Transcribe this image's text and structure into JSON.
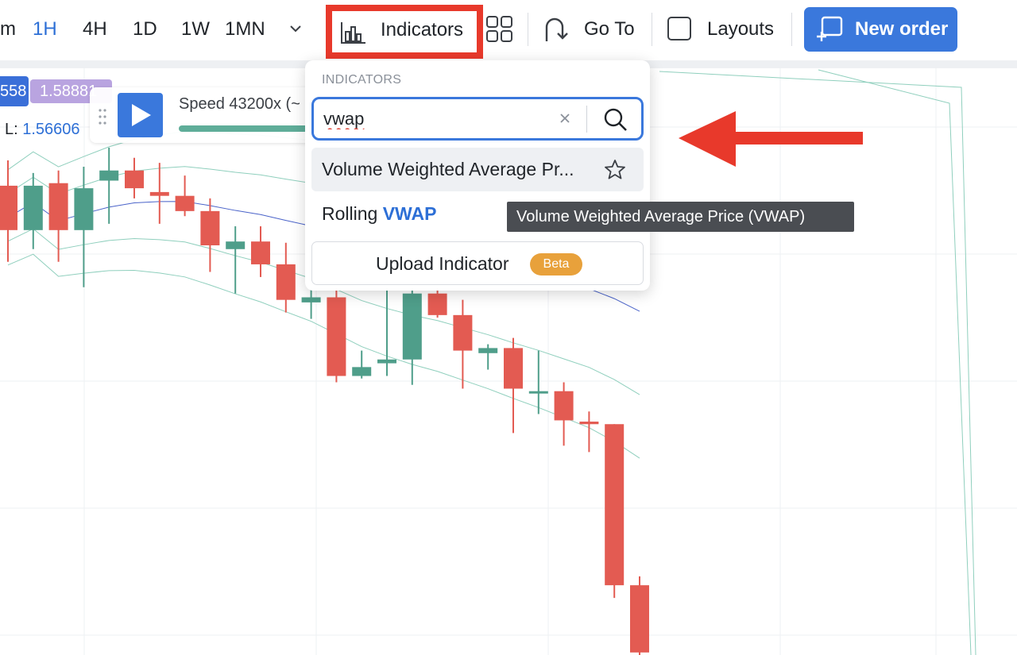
{
  "toolbar": {
    "timeframes": [
      {
        "label": "m",
        "active": false
      },
      {
        "label": "1H",
        "active": true
      },
      {
        "label": "4H",
        "active": false
      },
      {
        "label": "1D",
        "active": false
      },
      {
        "label": "1W",
        "active": false
      },
      {
        "label": "1MN",
        "active": false
      }
    ],
    "indicators_label": "Indicators",
    "goto_label": "Go To",
    "layouts_label": "Layouts",
    "new_order_label": "New order"
  },
  "price_labels": {
    "blue_tag": "558",
    "purple_tag": "1.58881",
    "low_prefix": "L:",
    "low_value": "1.56606"
  },
  "replay": {
    "speed_text": "Speed 43200x (~"
  },
  "dropdown": {
    "header": "INDICATORS",
    "search_value": "vwap",
    "results": [
      {
        "label": "Volume Weighted Average Pr..."
      },
      {
        "label_prefix": "Rolling ",
        "label_highlight": "VWAP"
      }
    ],
    "upload_label": "Upload Indicator",
    "beta_badge": "Beta"
  },
  "tooltip": "Volume Weighted Average Price (VWAP)",
  "colors": {
    "accent": "#3a78dc",
    "bull": "#4f9e8a",
    "bear": "#e35b52",
    "highlight_box": "#e8392b",
    "vwap_line": "#4a63c9",
    "band_line": "#8fcfbd"
  },
  "candles": [
    {
      "o": 1.57,
      "h": 1.572,
      "l": 1.564,
      "c": 1.5665
    },
    {
      "o": 1.5665,
      "h": 1.571,
      "l": 1.565,
      "c": 1.57
    },
    {
      "o": 1.5702,
      "h": 1.5712,
      "l": 1.564,
      "c": 1.5665
    },
    {
      "o": 1.5665,
      "h": 1.5715,
      "l": 1.562,
      "c": 1.5698
    },
    {
      "o": 1.5704,
      "h": 1.573,
      "l": 1.567,
      "c": 1.5712
    },
    {
      "o": 1.5712,
      "h": 1.5722,
      "l": 1.569,
      "c": 1.5698
    },
    {
      "o": 1.5695,
      "h": 1.5718,
      "l": 1.567,
      "c": 1.5692
    },
    {
      "o": 1.5692,
      "h": 1.5708,
      "l": 1.5676,
      "c": 1.568
    },
    {
      "o": 1.568,
      "h": 1.569,
      "l": 1.5632,
      "c": 1.5653
    },
    {
      "o": 1.565,
      "h": 1.5668,
      "l": 1.5615,
      "c": 1.5656
    },
    {
      "o": 1.5656,
      "h": 1.5668,
      "l": 1.5628,
      "c": 1.5638
    },
    {
      "o": 1.5638,
      "h": 1.5655,
      "l": 1.56,
      "c": 1.561
    },
    {
      "o": 1.5608,
      "h": 1.564,
      "l": 1.5595,
      "c": 1.5612
    },
    {
      "o": 1.5612,
      "h": 1.5622,
      "l": 1.5545,
      "c": 1.555
    },
    {
      "o": 1.555,
      "h": 1.557,
      "l": 1.5548,
      "c": 1.5557
    },
    {
      "o": 1.556,
      "h": 1.564,
      "l": 1.555,
      "c": 1.5563
    },
    {
      "o": 1.5563,
      "h": 1.562,
      "l": 1.5543,
      "c": 1.5615
    },
    {
      "o": 1.5615,
      "h": 1.562,
      "l": 1.5596,
      "c": 1.5598
    },
    {
      "o": 1.5598,
      "h": 1.561,
      "l": 1.554,
      "c": 1.557
    },
    {
      "o": 1.5568,
      "h": 1.5575,
      "l": 1.5555,
      "c": 1.5572
    },
    {
      "o": 1.5572,
      "h": 1.558,
      "l": 1.5505,
      "c": 1.554
    },
    {
      "o": 1.5538,
      "h": 1.557,
      "l": 1.552,
      "c": 1.5538
    },
    {
      "o": 1.5538,
      "h": 1.5545,
      "l": 1.5495,
      "c": 1.5515
    },
    {
      "o": 1.5514,
      "h": 1.5522,
      "l": 1.549,
      "c": 1.5512
    },
    {
      "o": 1.5512,
      "h": 1.5512,
      "l": 1.5375,
      "c": 1.5385
    },
    {
      "o": 1.5385,
      "h": 1.5392,
      "l": 1.533,
      "c": 1.5332
    }
  ]
}
